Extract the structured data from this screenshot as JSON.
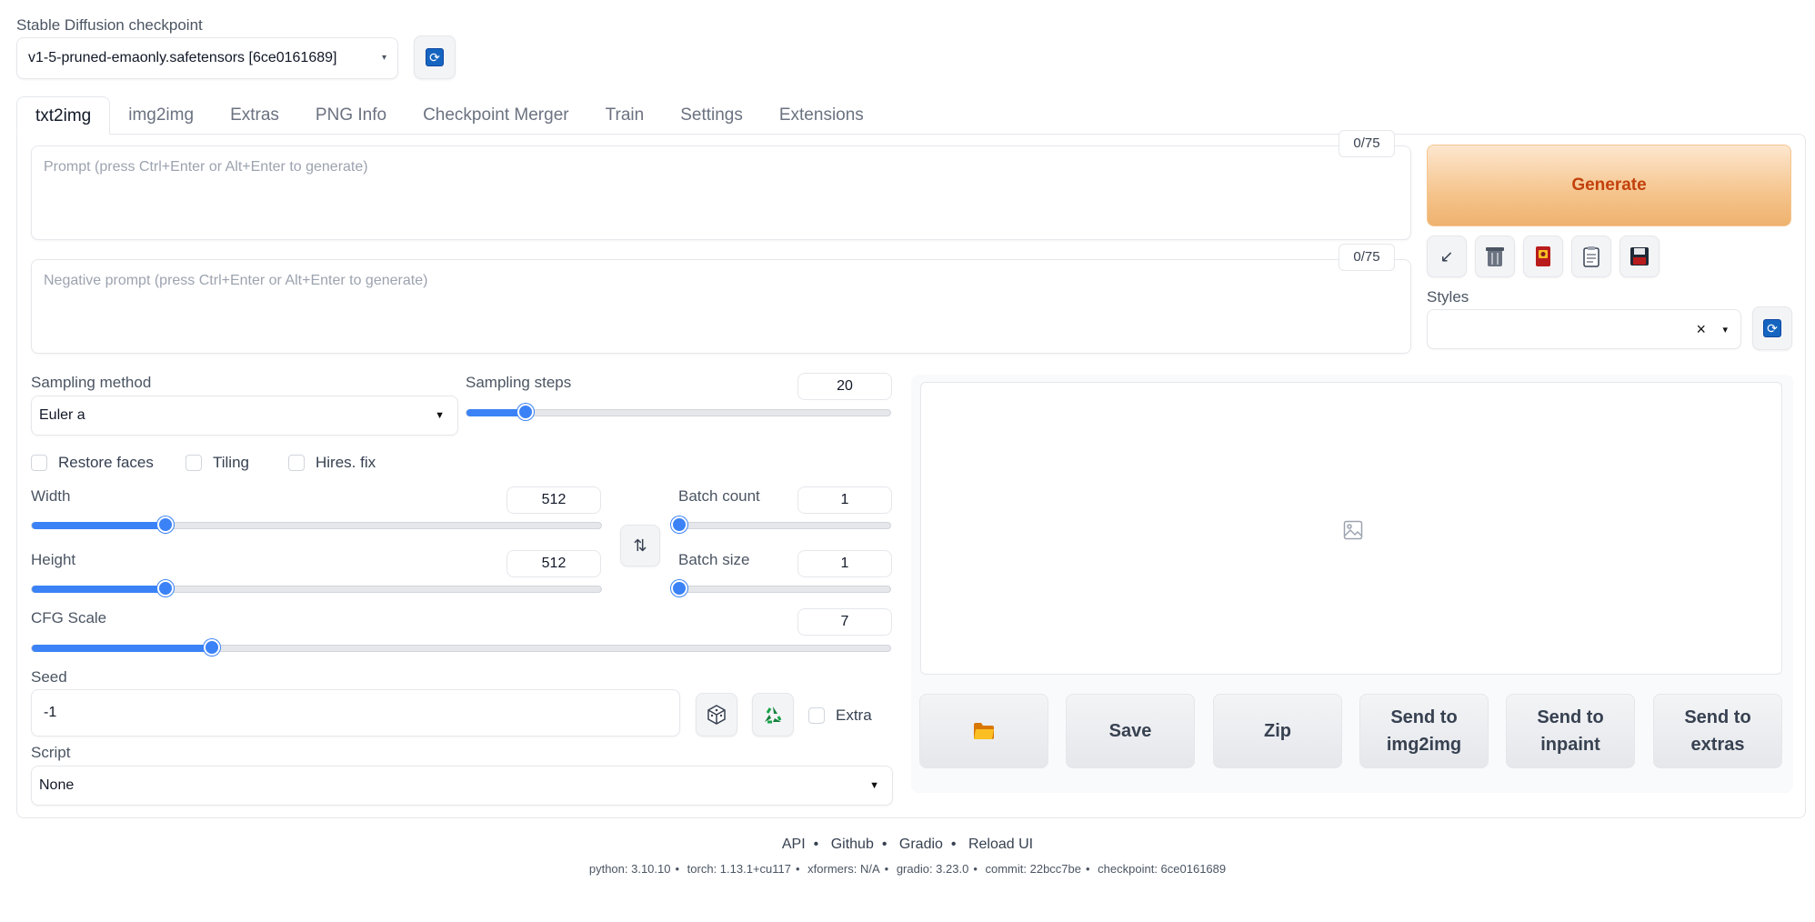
{
  "header": {
    "checkpoint_label": "Stable Diffusion checkpoint",
    "checkpoint_value": "v1-5-pruned-emaonly.safetensors [6ce0161689]"
  },
  "tabs": [
    {
      "label": "txt2img",
      "active": true
    },
    {
      "label": "img2img",
      "active": false
    },
    {
      "label": "Extras",
      "active": false
    },
    {
      "label": "PNG Info",
      "active": false
    },
    {
      "label": "Checkpoint Merger",
      "active": false
    },
    {
      "label": "Train",
      "active": false
    },
    {
      "label": "Settings",
      "active": false
    },
    {
      "label": "Extensions",
      "active": false
    }
  ],
  "prompt": {
    "placeholder": "Prompt (press Ctrl+Enter or Alt+Enter to generate)",
    "counter": "0/75"
  },
  "negative_prompt": {
    "placeholder": "Negative prompt (press Ctrl+Enter or Alt+Enter to generate)",
    "counter": "0/75"
  },
  "generate_label": "Generate",
  "tool_icons": [
    "arrow-down-left-icon",
    "trash-icon",
    "red-book-icon",
    "clipboard-icon",
    "floppy-disk-icon"
  ],
  "styles": {
    "label": "Styles",
    "clear": "×"
  },
  "sampling_method": {
    "label": "Sampling method",
    "value": "Euler a"
  },
  "sampling_steps": {
    "label": "Sampling steps",
    "value": "20",
    "fraction": 0.14
  },
  "checkboxes": {
    "restore_faces": "Restore faces",
    "tiling": "Tiling",
    "hires_fix": "Hires. fix",
    "extra": "Extra"
  },
  "width": {
    "label": "Width",
    "value": "512",
    "fraction": 0.235
  },
  "height": {
    "label": "Height",
    "value": "512",
    "fraction": 0.235
  },
  "batch_count": {
    "label": "Batch count",
    "value": "1",
    "fraction": 0.0
  },
  "batch_size": {
    "label": "Batch size",
    "value": "1",
    "fraction": 0.0
  },
  "cfg_scale": {
    "label": "CFG Scale",
    "value": "7",
    "fraction": 0.21
  },
  "seed": {
    "label": "Seed",
    "value": "-1"
  },
  "script": {
    "label": "Script",
    "value": "None"
  },
  "action_buttons": [
    {
      "label": "",
      "icon": "folder-icon"
    },
    {
      "label": "Save"
    },
    {
      "label": "Zip"
    },
    {
      "label": "Send to\nimg2img"
    },
    {
      "label": "Send to\ninpaint"
    },
    {
      "label": "Send to\nextras"
    }
  ],
  "footer": {
    "links": [
      "API",
      "Github",
      "Gradio",
      "Reload UI"
    ],
    "info": [
      "python: 3.10.10",
      "torch: 1.13.1+cu117",
      "xformers: N/A",
      "gradio: 3.23.0",
      "commit: 22bcc7be",
      "checkpoint: 6ce0161689"
    ]
  }
}
